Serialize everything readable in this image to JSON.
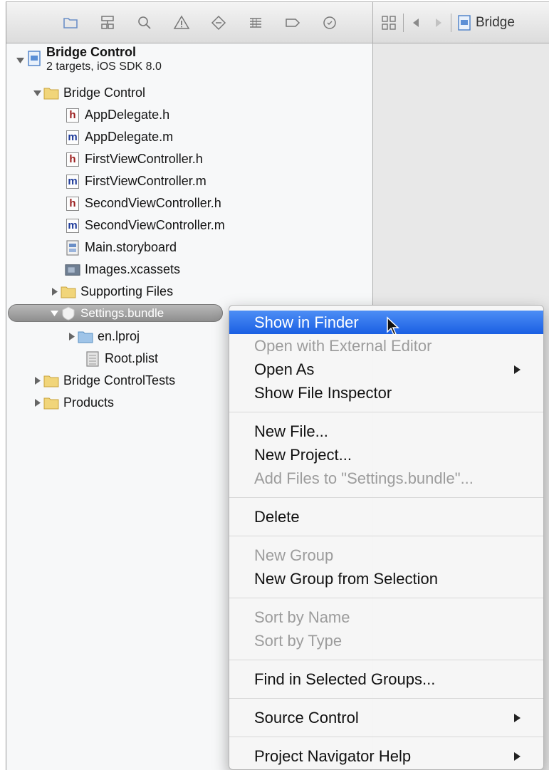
{
  "toolbar": {
    "icons": [
      "folder-icon",
      "hierarchy-icon",
      "search-icon",
      "warning-icon",
      "diamond-icon",
      "list-icon",
      "breakpoint-icon",
      "clock-icon"
    ]
  },
  "editor": {
    "breadcrumb": "Bridge"
  },
  "project": {
    "title": "Bridge Control",
    "subtitle": "2 targets, iOS SDK 8.0"
  },
  "tree": {
    "group_bridge_control": "Bridge Control",
    "files": [
      {
        "label": "AppDelegate.h",
        "type": "h"
      },
      {
        "label": "AppDelegate.m",
        "type": "m"
      },
      {
        "label": "FirstViewController.h",
        "type": "h"
      },
      {
        "label": "FirstViewController.m",
        "type": "m"
      },
      {
        "label": "SecondViewController.h",
        "type": "h"
      },
      {
        "label": "SecondViewController.m",
        "type": "m"
      }
    ],
    "storyboard": "Main.storyboard",
    "xcassets": "Images.xcassets",
    "supporting_files": "Supporting Files",
    "settings_bundle": "Settings.bundle",
    "en_lproj": "en.lproj",
    "root_plist": "Root.plist",
    "tests": "Bridge ControlTests",
    "products": "Products"
  },
  "context_menu": {
    "show_in_finder": "Show in Finder",
    "open_external": "Open with External Editor",
    "open_as": "Open As",
    "show_file_inspector": "Show File Inspector",
    "new_file": "New File...",
    "new_project": "New Project...",
    "add_files": "Add Files to \"Settings.bundle\"...",
    "delete": "Delete",
    "new_group": "New Group",
    "new_group_from_selection": "New Group from Selection",
    "sort_by_name": "Sort by Name",
    "sort_by_type": "Sort by Type",
    "find_in_groups": "Find in Selected Groups...",
    "source_control": "Source Control",
    "project_navigator_help": "Project Navigator Help"
  },
  "colors": {
    "highlight": "#2f74ec",
    "folder": "#f1d57a",
    "disabled_text": "#9c9c9c"
  }
}
